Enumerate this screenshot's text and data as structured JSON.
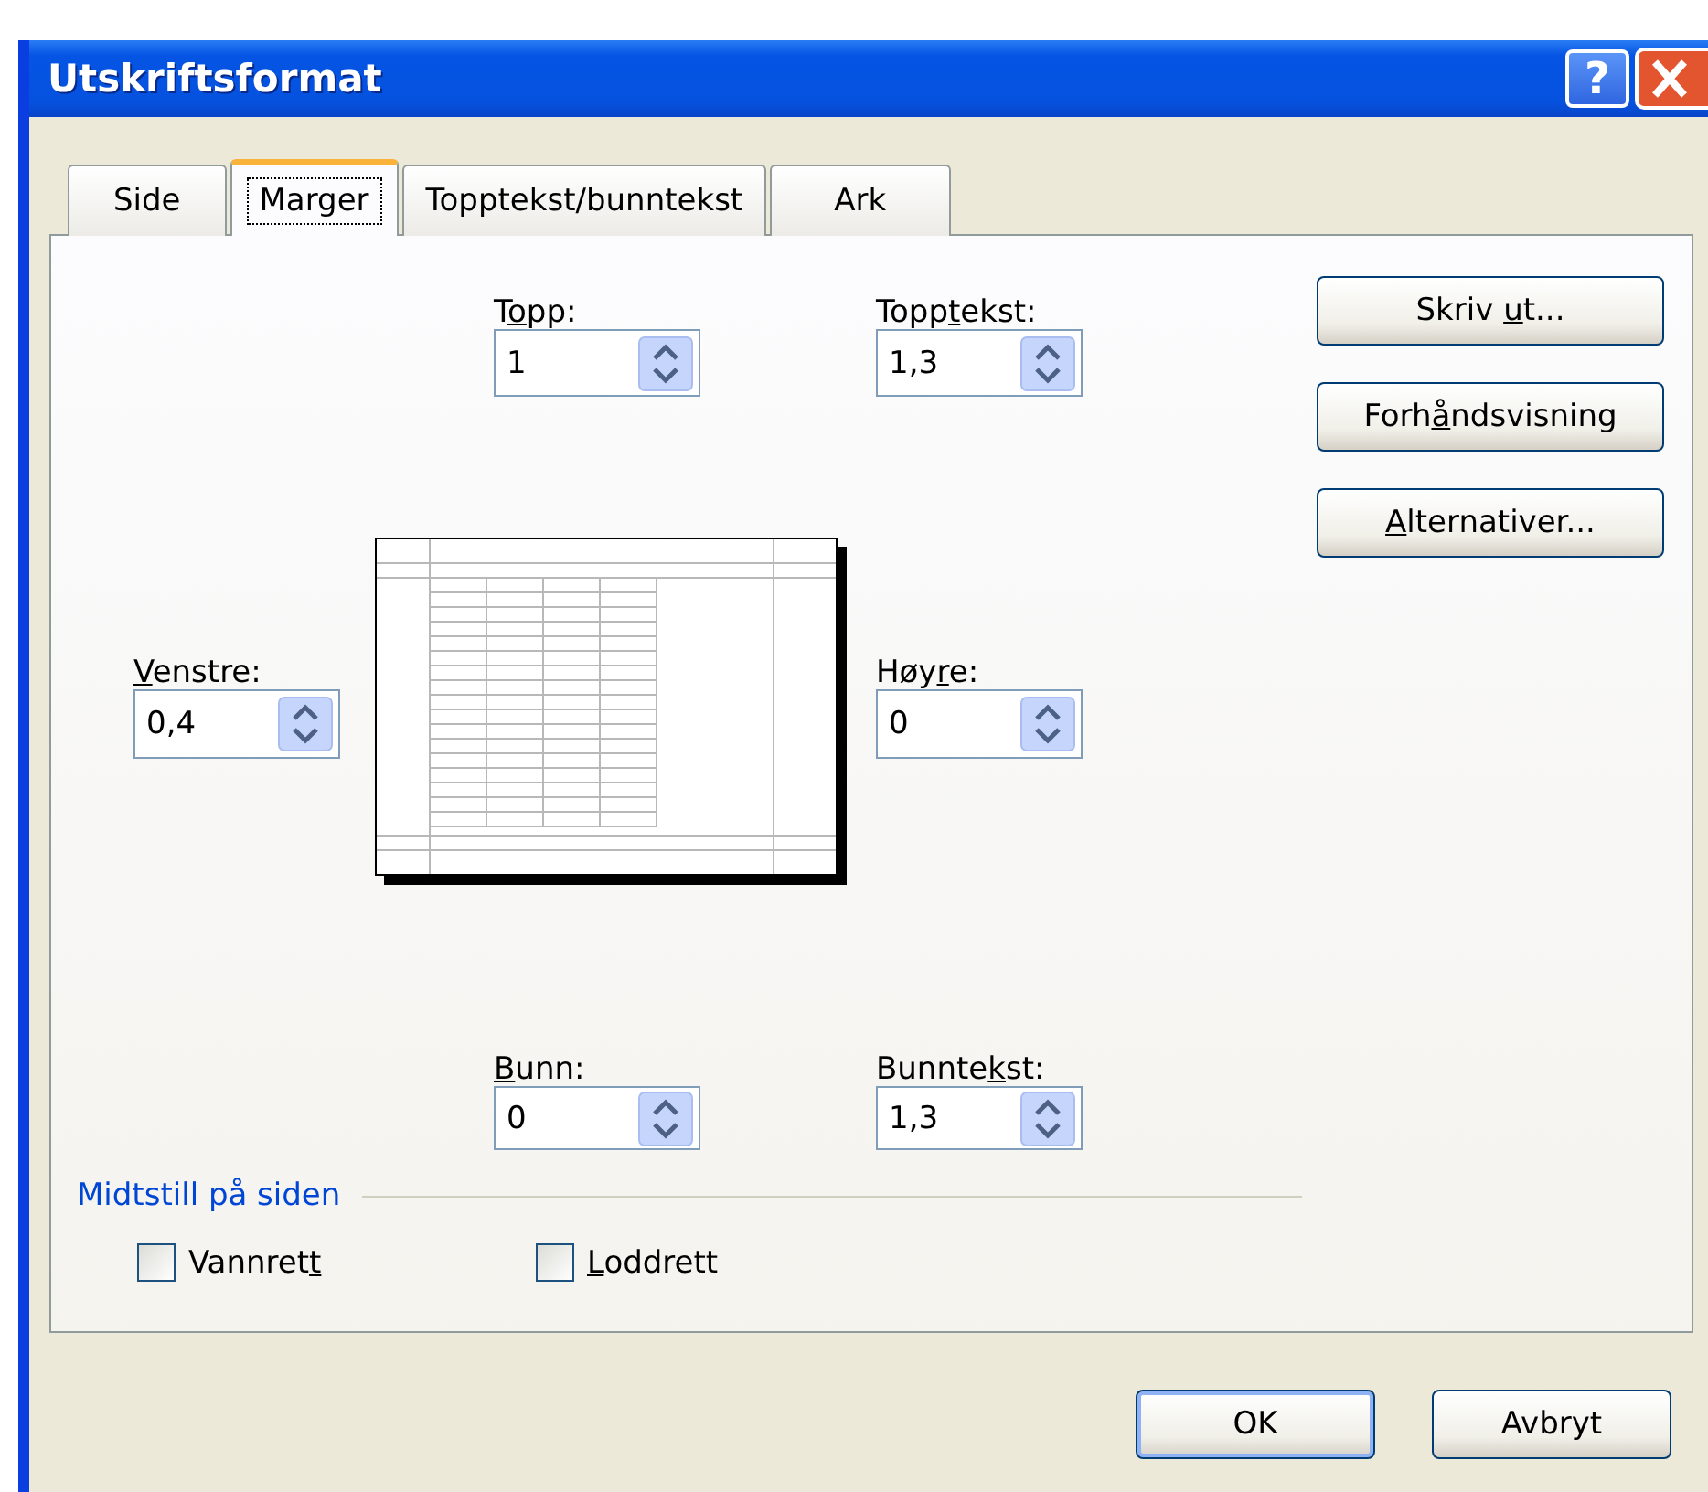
{
  "window": {
    "title": "Utskriftsformat",
    "help_button": "?"
  },
  "tabs": [
    {
      "label": "Side",
      "selected": false
    },
    {
      "label": "Marger",
      "selected": true
    },
    {
      "label": "Topptekst/bunntekst",
      "selected": false
    },
    {
      "label": "Ark",
      "selected": false
    }
  ],
  "fields": [
    {
      "kind": "top",
      "label": [
        {
          "text": "T",
          "underline": false
        },
        {
          "text": "o",
          "underline": true
        },
        {
          "text": "pp:",
          "underline": false
        }
      ],
      "value": "1"
    },
    {
      "kind": "header",
      "label": [
        {
          "text": "Topp",
          "underline": false
        },
        {
          "text": "t",
          "underline": true
        },
        {
          "text": "e",
          "underline": false
        },
        {
          "text": "kst:",
          "underline": false
        }
      ],
      "value": "1,3"
    },
    {
      "kind": "left",
      "label": [
        {
          "text": "V",
          "underline": true
        },
        {
          "text": "enstre:",
          "underline": false
        }
      ],
      "value": "0,4"
    },
    {
      "kind": "right",
      "label": [
        {
          "text": "Høy",
          "underline": false
        },
        {
          "text": "r",
          "underline": true
        },
        {
          "text": "e:",
          "underline": false
        }
      ],
      "value": "0"
    },
    {
      "kind": "bottom",
      "label": [
        {
          "text": "B",
          "underline": true
        },
        {
          "text": "unn:",
          "underline": false
        }
      ],
      "value": "0"
    },
    {
      "kind": "footer",
      "label": [
        {
          "text": "Bunnte",
          "underline": false
        },
        {
          "text": "k",
          "underline": true
        },
        {
          "text": "st:",
          "underline": false
        }
      ],
      "value": "1,3"
    }
  ],
  "side_buttons": [
    {
      "label": [
        {
          "text": "Skriv ",
          "underline": false
        },
        {
          "text": "u",
          "underline": true
        },
        {
          "text": "t...",
          "underline": false
        }
      ]
    },
    {
      "label": [
        {
          "text": "Forh",
          "underline": false
        },
        {
          "text": "å",
          "underline": true
        },
        {
          "text": "ndsvisning",
          "underline": false
        }
      ]
    },
    {
      "label": [
        {
          "text": "A",
          "underline": true
        },
        {
          "text": "lternativer...",
          "underline": false
        }
      ]
    }
  ],
  "center_on_page": {
    "title": "Midtstill på siden",
    "options": [
      {
        "label": [
          {
            "text": "Vannret",
            "underline": false
          },
          {
            "text": "t",
            "underline": true
          }
        ],
        "checked": false
      },
      {
        "label": [
          {
            "text": "L",
            "underline": true
          },
          {
            "text": "oddrett",
            "underline": false
          }
        ],
        "checked": false
      }
    ]
  },
  "dialog_buttons": [
    {
      "label": "OK",
      "default": true
    },
    {
      "label": "Avbryt",
      "default": false
    }
  ]
}
